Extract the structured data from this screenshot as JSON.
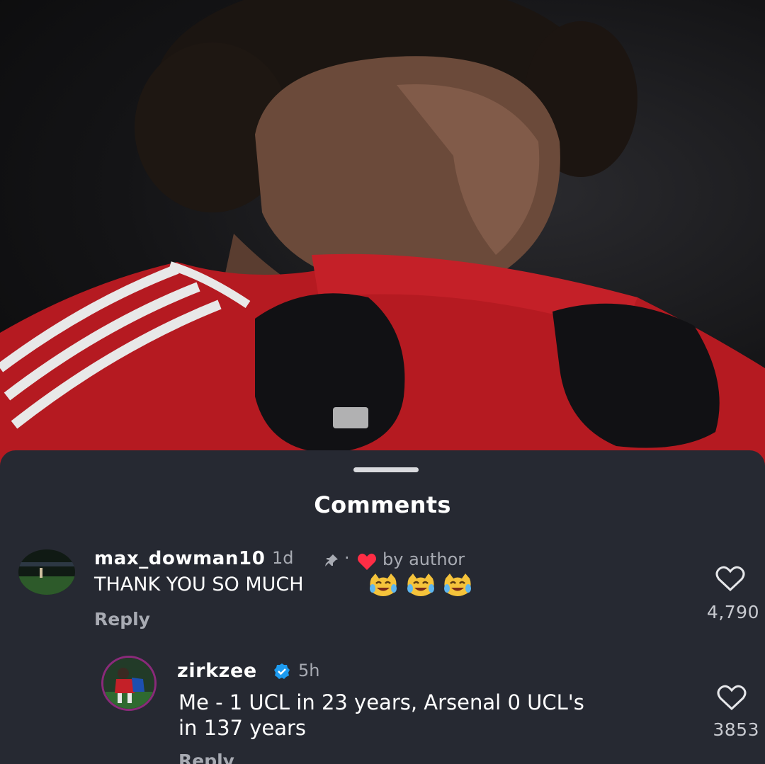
{
  "sheet": {
    "title": "Comments"
  },
  "comments": [
    {
      "username": "max_dowman10",
      "time": "1d",
      "pinned_separator": "·",
      "liked_by_label": "by author",
      "text": "THANK YOU SO MUCH",
      "emoji": [
        "face-with-tears-of-joy-cat",
        "face-with-tears-of-joy-cat",
        "face-with-tears-of-joy-cat"
      ],
      "reply_label": "Reply",
      "likes": "4,790"
    },
    {
      "username": "zirkzee",
      "verified": true,
      "time": "5h",
      "text_line1": "Me - 1 UCL in 23 years, Arsenal 0 UCL's",
      "text_line2": "in 137 years",
      "reply_label": "Reply",
      "likes": "3853"
    }
  ],
  "colors": {
    "sheet_bg": "#262932",
    "text_primary": "#ffffff",
    "text_secondary": "#a8abb3",
    "heart_red": "#ff2d45",
    "verified_blue": "#1d9bf0"
  },
  "icons": [
    "pin-icon",
    "heart-icon",
    "like-heart-icon",
    "verified-badge-icon"
  ]
}
